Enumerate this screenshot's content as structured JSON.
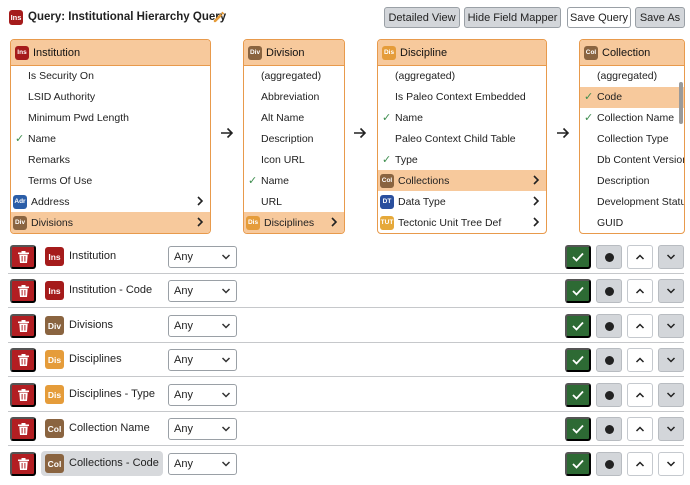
{
  "header": {
    "icon_text": "Ins",
    "title": "Query: Institutional Hierarchy Query",
    "buttons": {
      "detailed_view": "Detailed View",
      "hide_field_mapper": "Hide Field Mapper",
      "save_query": "Save Query",
      "save_as": "Save As"
    }
  },
  "colors": {
    "institution": "#a51b1b",
    "division": "#8a6440",
    "discipline": "#e59c3a",
    "collection": "#8a6440",
    "address": "#2b5ea8",
    "data_type": "#2a4f9e",
    "tectonic": "#e6a93a",
    "panel_header": "#f7c99c",
    "panel_border": "#e89a4c",
    "check_green": "#2d6a34",
    "trash_red": "#b21e22"
  },
  "panels": [
    {
      "badge": "Ins",
      "title": "Institution",
      "fields": [
        {
          "label": "Is Security On",
          "checked": false
        },
        {
          "label": "LSID Authority",
          "checked": false
        },
        {
          "label": "Minimum Pwd Length",
          "checked": false
        },
        {
          "label": "Name",
          "checked": true
        },
        {
          "label": "Remarks",
          "checked": false
        },
        {
          "label": "Terms Of Use",
          "checked": false
        },
        {
          "label": "Address",
          "badge": "Adr",
          "relationship": true
        },
        {
          "label": "Divisions",
          "badge": "Div",
          "relationship": true,
          "selected": true
        }
      ]
    },
    {
      "badge": "Div",
      "title": "Division",
      "fields": [
        {
          "label": "(aggregated)",
          "checked": false
        },
        {
          "label": "Abbreviation",
          "checked": false
        },
        {
          "label": "Alt Name",
          "checked": false
        },
        {
          "label": "Description",
          "checked": false
        },
        {
          "label": "Icon URL",
          "checked": false
        },
        {
          "label": "Name",
          "checked": true
        },
        {
          "label": "URL",
          "checked": false
        },
        {
          "label": "Disciplines",
          "badge": "Dis",
          "relationship": true,
          "selected": true
        }
      ]
    },
    {
      "badge": "Dis",
      "title": "Discipline",
      "fields": [
        {
          "label": "(aggregated)",
          "checked": false
        },
        {
          "label": "Is Paleo Context Embedded",
          "checked": false
        },
        {
          "label": "Name",
          "checked": true
        },
        {
          "label": "Paleo Context Child Table",
          "checked": false
        },
        {
          "label": "Type",
          "checked": true
        },
        {
          "label": "Collections",
          "badge": "Col",
          "relationship": true,
          "selected": true
        },
        {
          "label": "Data Type",
          "badge": "DT",
          "relationship": true
        },
        {
          "label": "Tectonic Unit Tree Def",
          "badge": "TUT",
          "relationship": true
        }
      ]
    },
    {
      "badge": "Col",
      "title": "Collection",
      "fields": [
        {
          "label": "(aggregated)",
          "checked": false
        },
        {
          "label": "Code",
          "checked": true,
          "selected": true
        },
        {
          "label": "Collection Name",
          "checked": true
        },
        {
          "label": "Collection Type",
          "checked": false
        },
        {
          "label": "Db Content Version",
          "checked": false
        },
        {
          "label": "Description",
          "checked": false
        },
        {
          "label": "Development Status",
          "checked": false
        },
        {
          "label": "GUID",
          "checked": false
        }
      ]
    }
  ],
  "lines": [
    {
      "badge": "Ins",
      "label": "Institution",
      "operator": "Any"
    },
    {
      "badge": "Ins",
      "label": "Institution - Code",
      "operator": "Any"
    },
    {
      "badge": "Div",
      "label": "Divisions",
      "operator": "Any"
    },
    {
      "badge": "Dis",
      "label": "Disciplines",
      "operator": "Any"
    },
    {
      "badge": "Dis",
      "label": "Disciplines - Type",
      "operator": "Any"
    },
    {
      "badge": "Col",
      "label": "Collection Name",
      "operator": "Any"
    },
    {
      "badge": "Col",
      "label": "Collections - Code",
      "operator": "Any",
      "highlighted": true
    }
  ]
}
